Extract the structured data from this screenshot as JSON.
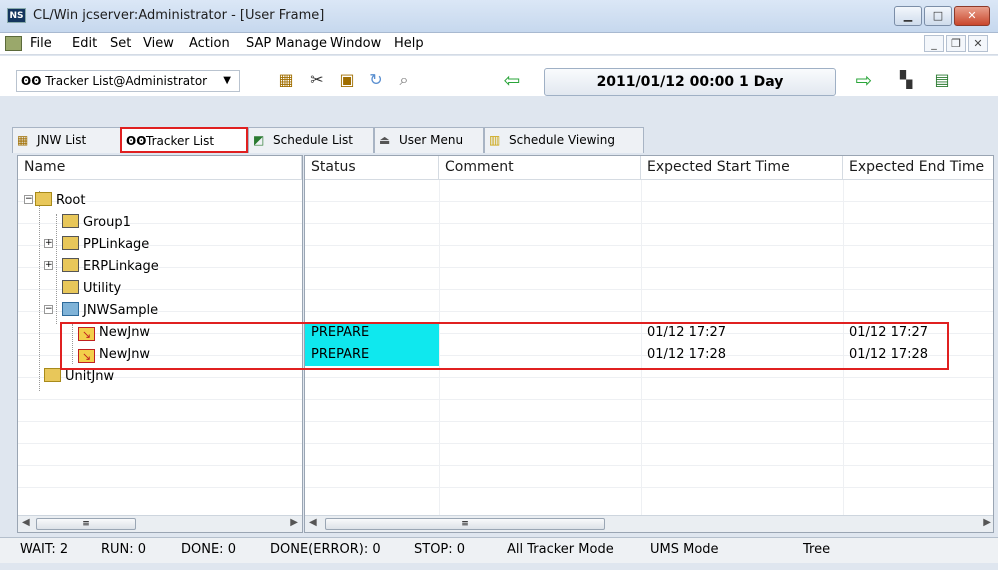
{
  "window": {
    "title": "CL/Win jcserver:Administrator - [User Frame]",
    "app_icon_text": "NS"
  },
  "menu": [
    "File",
    "Edit",
    "Set",
    "View",
    "Action",
    "SAP Manage",
    "Window",
    "Help"
  ],
  "toolbar": {
    "combo_value": "Tracker List@Administrator",
    "date_label": "2011/01/12 00:00   1 Day"
  },
  "tabs": [
    "JNW List",
    "Tracker List",
    "Schedule List",
    "User Menu",
    "Schedule Viewing"
  ],
  "tree": {
    "header": "Name",
    "nodes": [
      "Root",
      "Group1",
      "PPLinkage",
      "ERPLinkage",
      "Utility",
      "JNWSample",
      "NewJnw",
      "NewJnw",
      "UnitJnw"
    ]
  },
  "grid": {
    "headers": [
      "Status",
      "Comment",
      "Expected Start Time",
      "Expected End Time"
    ],
    "rows": [
      {
        "status": "PREPARE",
        "comment": "",
        "start": "01/12 17:27",
        "end": "01/12 17:27"
      },
      {
        "status": "PREPARE",
        "comment": "",
        "start": "01/12 17:28",
        "end": "01/12 17:28"
      }
    ]
  },
  "statusbar": {
    "wait": "WAIT: 2",
    "run": "RUN: 0",
    "done": "DONE: 0",
    "done_error": "DONE(ERROR): 0",
    "stop": "STOP: 0",
    "mode": "All Tracker Mode",
    "ums": "UMS Mode",
    "view": "Tree"
  },
  "colors": {
    "status_highlight": "#0fe8ee",
    "annotation_red": "#e02020"
  }
}
